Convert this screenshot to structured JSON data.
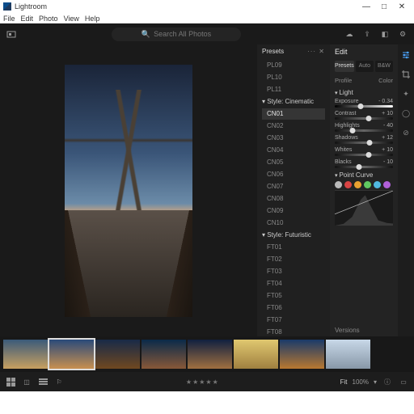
{
  "os": {
    "title": "Lightroom",
    "controls": {
      "min": "—",
      "max": "□",
      "close": "✕"
    }
  },
  "menu": [
    "File",
    "Edit",
    "Photo",
    "View",
    "Help"
  ],
  "toolbar": {
    "search_placeholder": "Search All Photos"
  },
  "presets": {
    "title": "Presets",
    "items": [
      {
        "label": "PL09",
        "type": "item"
      },
      {
        "label": "PL10",
        "type": "item"
      },
      {
        "label": "PL11",
        "type": "item"
      },
      {
        "label": "Style: Cinematic",
        "type": "group"
      },
      {
        "label": "CN01",
        "type": "item",
        "selected": true
      },
      {
        "label": "CN02",
        "type": "item"
      },
      {
        "label": "CN03",
        "type": "item"
      },
      {
        "label": "CN04",
        "type": "item"
      },
      {
        "label": "CN05",
        "type": "item"
      },
      {
        "label": "CN06",
        "type": "item"
      },
      {
        "label": "CN07",
        "type": "item"
      },
      {
        "label": "CN08",
        "type": "item"
      },
      {
        "label": "CN09",
        "type": "item"
      },
      {
        "label": "CN10",
        "type": "item"
      },
      {
        "label": "Style: Futuristic",
        "type": "group"
      },
      {
        "label": "FT01",
        "type": "item"
      },
      {
        "label": "FT02",
        "type": "item"
      },
      {
        "label": "FT03",
        "type": "item"
      },
      {
        "label": "FT04",
        "type": "item"
      },
      {
        "label": "FT05",
        "type": "item"
      },
      {
        "label": "FT06",
        "type": "item"
      },
      {
        "label": "FT07",
        "type": "item"
      },
      {
        "label": "FT08",
        "type": "item"
      }
    ]
  },
  "edit": {
    "title": "Edit",
    "tabs": [
      "Presets",
      "Auto",
      "B&W"
    ],
    "profile_label": "Profile",
    "profile_value": "Color",
    "section_light": "Light",
    "sliders": [
      {
        "name": "Exposure",
        "value": "- 0.34",
        "pos": 44,
        "grad": "grad-exp"
      },
      {
        "name": "Contrast",
        "value": "+ 10",
        "pos": 58,
        "grad": "grad-bw"
      },
      {
        "name": "Highlights",
        "value": "- 40",
        "pos": 30,
        "grad": "grad-bw"
      },
      {
        "name": "Shadows",
        "value": "+ 12",
        "pos": 60,
        "grad": "grad-bw"
      },
      {
        "name": "Whites",
        "value": "+ 10",
        "pos": 58,
        "grad": "grad-bw"
      },
      {
        "name": "Blacks",
        "value": "- 10",
        "pos": 42,
        "grad": "grad-bw"
      }
    ],
    "point_curve": "Point Curve",
    "versions": "Versions"
  },
  "filmstrip": {
    "thumbs": [
      {
        "bg": "linear-gradient(#3a5a7a,#c8a060)",
        "sel": false
      },
      {
        "bg": "linear-gradient(#2a4a7a,#c89050)",
        "sel": true
      },
      {
        "bg": "linear-gradient(#182a48,#704820)",
        "sel": false
      },
      {
        "bg": "linear-gradient(#0a2a4a,#885838)",
        "sel": false
      },
      {
        "bg": "linear-gradient(#102040,#a07040)",
        "sel": false
      },
      {
        "bg": "linear-gradient(#e0c870,#a08040)",
        "sel": false
      },
      {
        "bg": "linear-gradient(#1a3a6a,#b87830)",
        "sel": false
      },
      {
        "bg": "linear-gradient(#c8d8e8,#8898a8)",
        "sel": false
      }
    ]
  },
  "status": {
    "stars": "★★★★★",
    "fit_label": "Fit",
    "zoom": "100%"
  },
  "swatch_colors": [
    "#bbb",
    "#d84444",
    "#e8a030",
    "#60c860",
    "#50b8e0",
    "#b060d8"
  ]
}
